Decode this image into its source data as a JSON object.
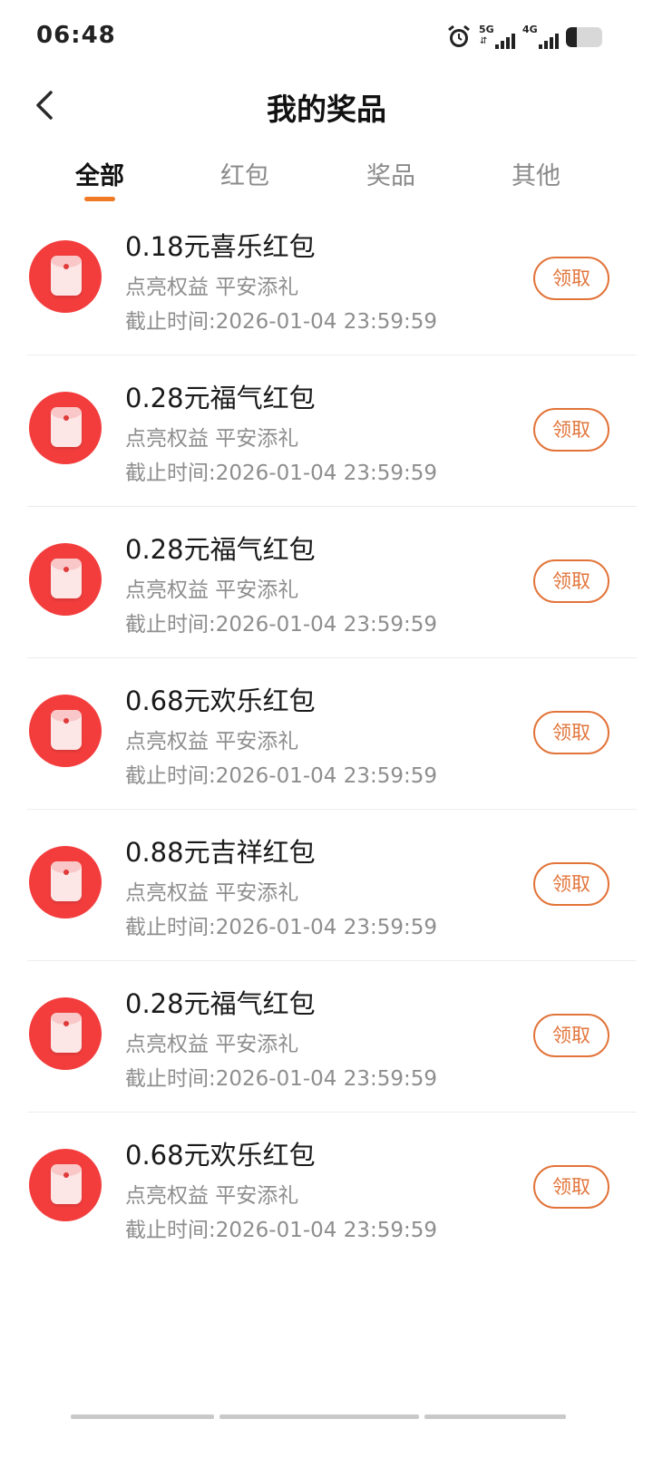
{
  "status": {
    "time": "06:48",
    "net1": "5G",
    "net2": "4G",
    "battery_level": 0.3
  },
  "header": {
    "title": "我的奖品"
  },
  "tabs": [
    {
      "label": "全部",
      "active": true
    },
    {
      "label": "红包",
      "active": false
    },
    {
      "label": "奖品",
      "active": false
    },
    {
      "label": "其他",
      "active": false
    }
  ],
  "items": [
    {
      "name": "0.18元喜乐红包",
      "sub": "点亮权益 平安添礼",
      "deadline": "截止时间:2026-01-04 23:59:59",
      "action": "领取"
    },
    {
      "name": "0.28元福气红包",
      "sub": "点亮权益 平安添礼",
      "deadline": "截止时间:2026-01-04 23:59:59",
      "action": "领取"
    },
    {
      "name": "0.28元福气红包",
      "sub": "点亮权益 平安添礼",
      "deadline": "截止时间:2026-01-04 23:59:59",
      "action": "领取"
    },
    {
      "name": "0.68元欢乐红包",
      "sub": "点亮权益 平安添礼",
      "deadline": "截止时间:2026-01-04 23:59:59",
      "action": "领取"
    },
    {
      "name": "0.88元吉祥红包",
      "sub": "点亮权益 平安添礼",
      "deadline": "截止时间:2026-01-04 23:59:59",
      "action": "领取"
    },
    {
      "name": "0.28元福气红包",
      "sub": "点亮权益 平安添礼",
      "deadline": "截止时间:2026-01-04 23:59:59",
      "action": "领取"
    },
    {
      "name": "0.68元欢乐红包",
      "sub": "点亮权益 平安添礼",
      "deadline": "截止时间:2026-01-04 23:59:59",
      "action": "领取"
    }
  ],
  "colors": {
    "accent": "#f07a24",
    "claim": "#e2743a",
    "envelope": "#f33d3d"
  },
  "icons": {
    "back": "chevron-left-icon",
    "envelope": "red-envelope-icon",
    "alarm": "alarm-clock-icon"
  }
}
